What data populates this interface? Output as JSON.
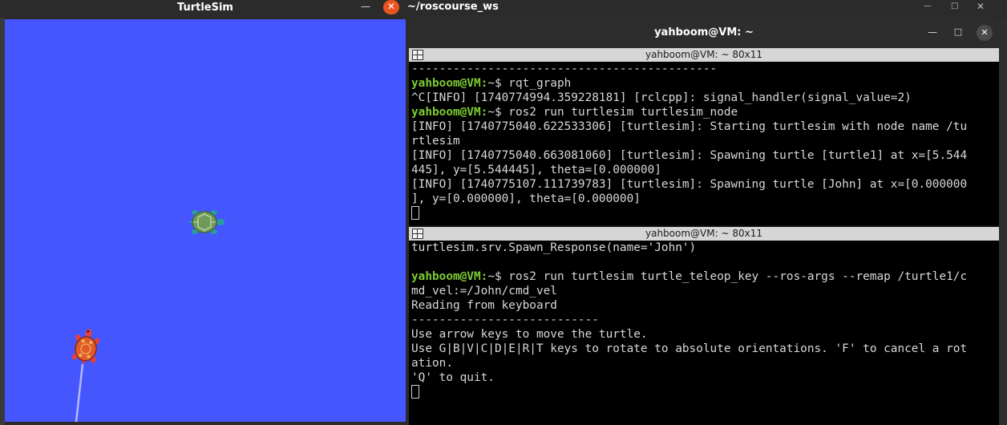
{
  "turtlesim": {
    "title": "TurtleSim",
    "minimize_glyph": "—",
    "close_glyph": "✕",
    "background_color": "#4556ff"
  },
  "workspace": {
    "title": "~/roscourse_ws",
    "minimize_glyph": "—",
    "maximize_glyph": "□",
    "close_glyph": "✕"
  },
  "terminal": {
    "title": "yahboom@VM: ~",
    "minimize_glyph": "—",
    "maximize_glyph": "□",
    "close_glyph": "✕",
    "pane_top": {
      "title": "yahboom@VM: ~ 80x11",
      "lines": [
        {
          "prompt": "",
          "text": "--------------------------------------------"
        },
        {
          "prompt": "yahboom@VM:",
          "text": "~$ rqt_graph"
        },
        {
          "prompt": "",
          "text": "^C[INFO] [1740774994.359228181] [rclcpp]: signal_handler(signal_value=2)"
        },
        {
          "prompt": "yahboom@VM:",
          "text": "~$ ros2 run turtlesim turtlesim_node"
        },
        {
          "prompt": "",
          "text": "[INFO] [1740775040.622533306] [turtlesim]: Starting turtlesim with node name /tu"
        },
        {
          "prompt": "",
          "text": "rtlesim"
        },
        {
          "prompt": "",
          "text": "[INFO] [1740775040.663081060] [turtlesim]: Spawning turtle [turtle1] at x=[5.544"
        },
        {
          "prompt": "",
          "text": "445], y=[5.544445], theta=[0.000000]"
        },
        {
          "prompt": "",
          "text": "[INFO] [1740775107.111739783] [turtlesim]: Spawning turtle [John] at x=[0.000000"
        },
        {
          "prompt": "",
          "text": "], y=[0.000000], theta=[0.000000]"
        }
      ]
    },
    "pane_bottom": {
      "title": "yahboom@VM: ~ 80x11",
      "lines": [
        {
          "prompt": "",
          "text": "turtlesim.srv.Spawn_Response(name='John')"
        },
        {
          "prompt": "",
          "text": ""
        },
        {
          "prompt": "yahboom@VM:",
          "text": "~$ ros2 run turtlesim turtle_teleop_key --ros-args --remap /turtle1/c"
        },
        {
          "prompt": "",
          "text": "md_vel:=/John/cmd_vel"
        },
        {
          "prompt": "",
          "text": "Reading from keyboard"
        },
        {
          "prompt": "",
          "text": "---------------------------"
        },
        {
          "prompt": "",
          "text": "Use arrow keys to move the turtle."
        },
        {
          "prompt": "",
          "text": "Use G|B|V|C|D|E|R|T keys to rotate to absolute orientations. 'F' to cancel a rot"
        },
        {
          "prompt": "",
          "text": "ation."
        },
        {
          "prompt": "",
          "text": "'Q' to quit."
        }
      ]
    }
  }
}
